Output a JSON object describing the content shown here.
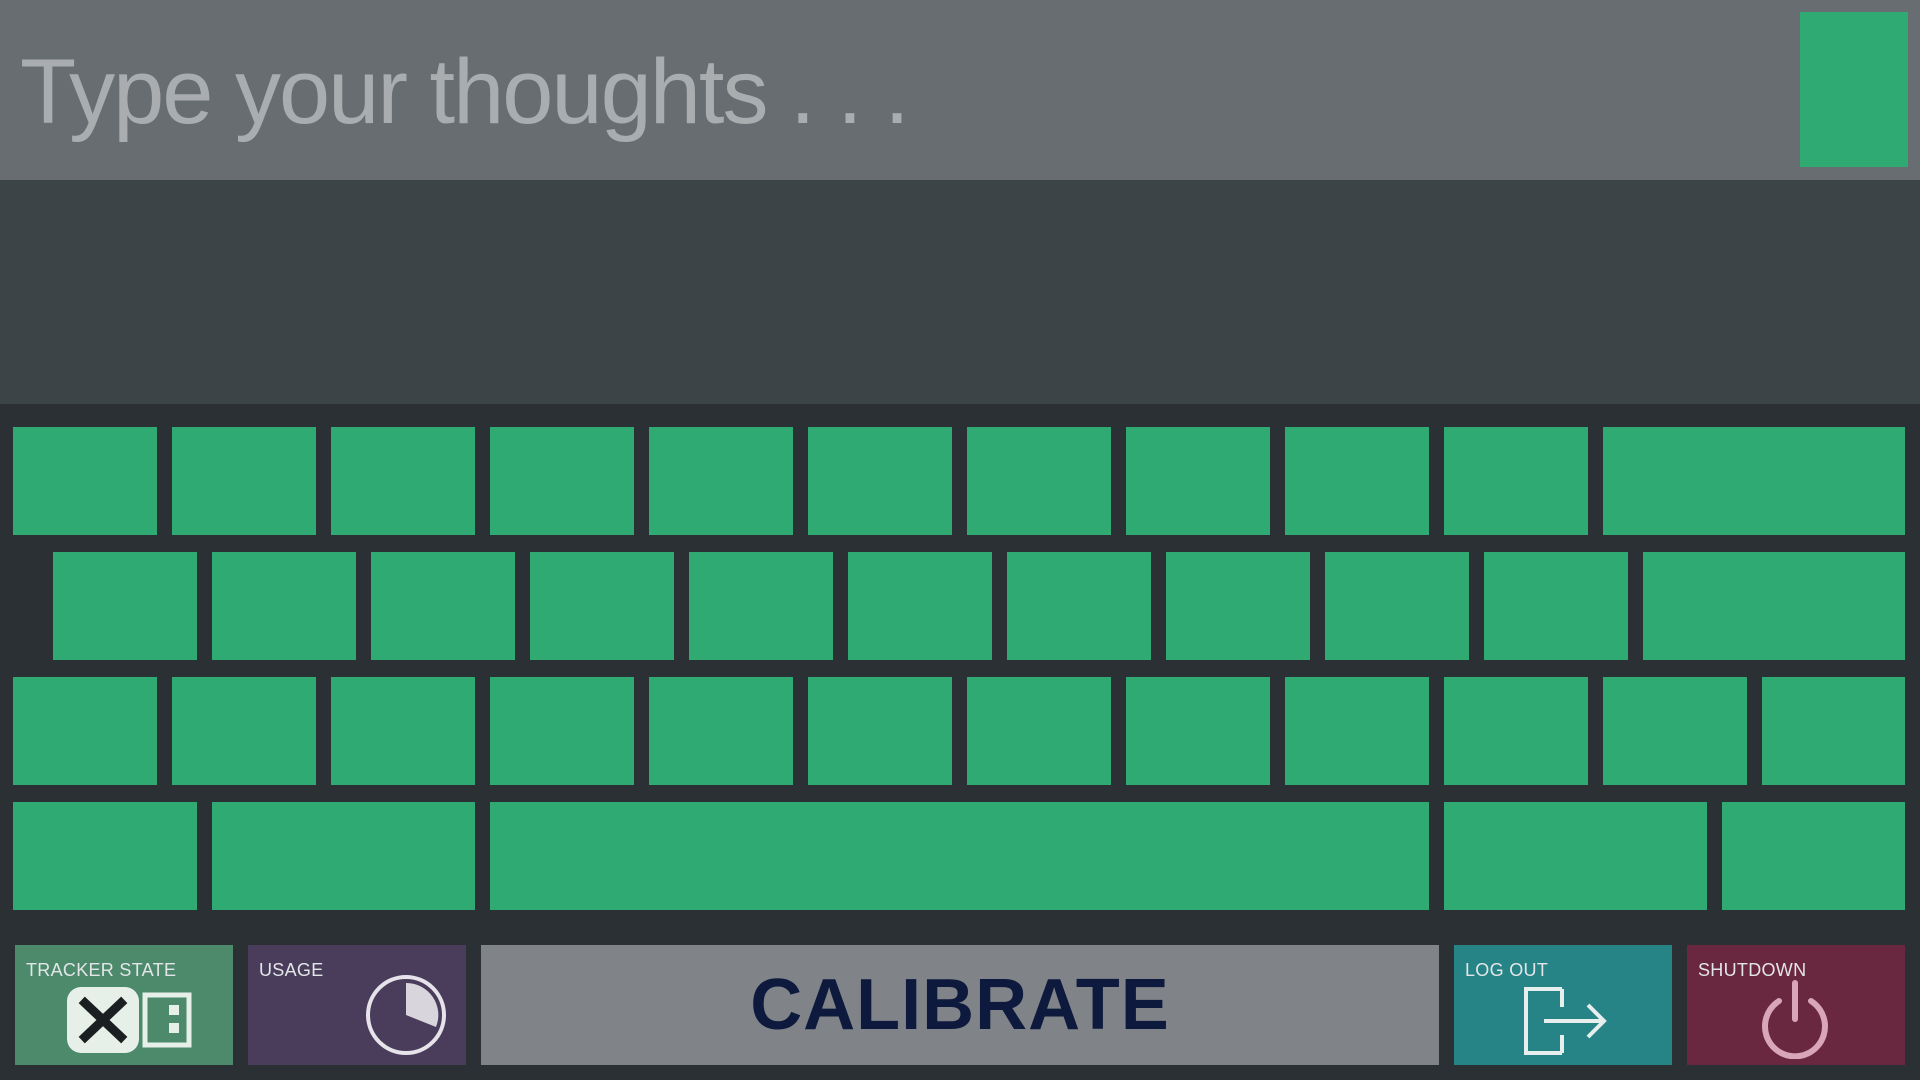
{
  "input": {
    "placeholder": "Type your thoughts . . ."
  },
  "keyboard": {
    "key_color": "#2eaa72",
    "row_count": 4
  },
  "bottom_bar": {
    "tracker_state_label": "TRACKER STATE",
    "usage_label": "USAGE",
    "calibrate_label": "CALIBRATE",
    "logout_label": "LOG OUT",
    "shutdown_label": "SHUTDOWN"
  },
  "colors": {
    "accent_green": "#2eaa72",
    "tracker_state_bg": "#4d8a6c",
    "usage_bg": "#4a3d5c",
    "calibrate_bg": "#808488",
    "logout_bg": "#268386",
    "shutdown_bg": "#6a2840"
  }
}
